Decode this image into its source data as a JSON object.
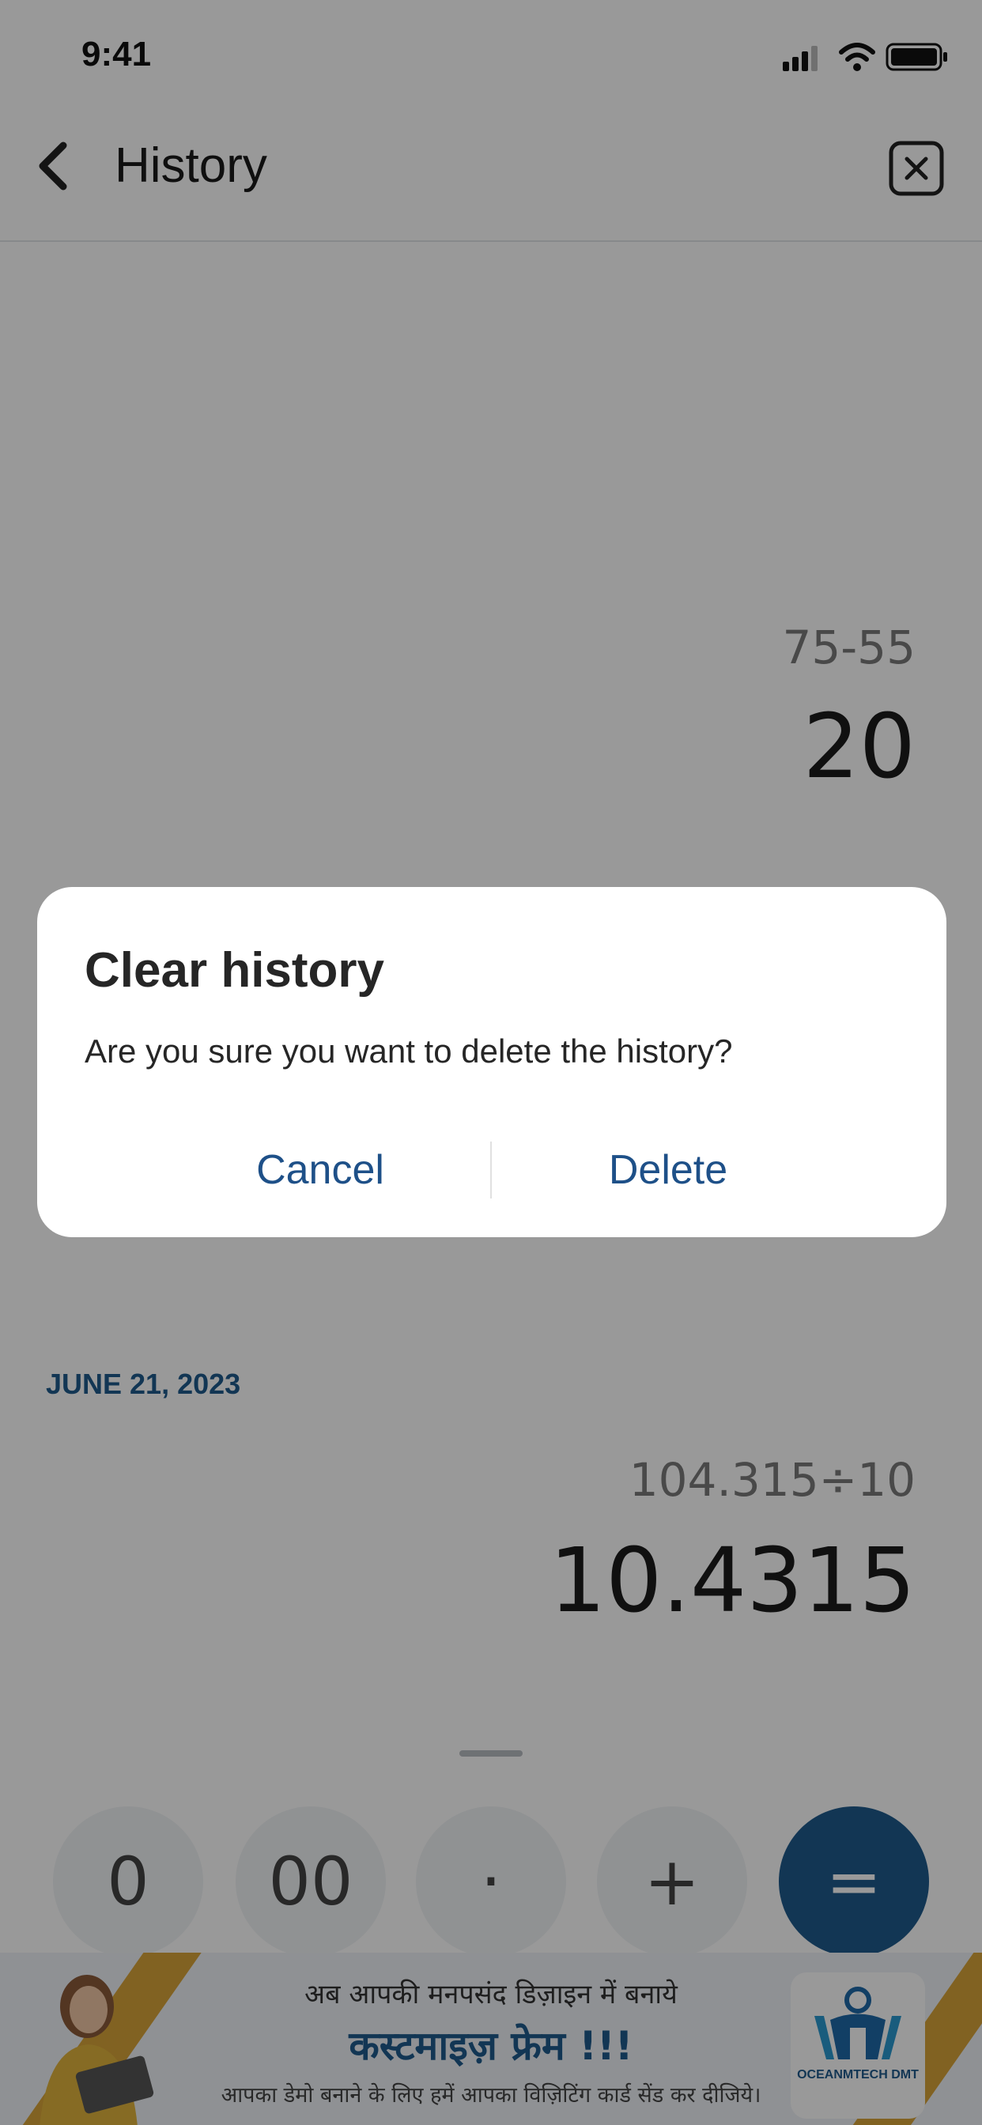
{
  "status_bar": {
    "time": "9:41"
  },
  "header": {
    "title": "History"
  },
  "history": {
    "entries": [
      {
        "expression": "75-55",
        "result": "20"
      },
      {
        "date": "JUNE 21, 2023",
        "expression": "104.315÷10",
        "result": "10.4315"
      }
    ]
  },
  "keypad": {
    "keys": [
      "0",
      "00",
      "·",
      "+",
      "="
    ]
  },
  "banner": {
    "line1": "अब आपकी मनपसंद डिज़ाइन में बनाये",
    "line2": "कस्टमाइज़ फ्रेम !!!",
    "line3": "आपका डेमो बनाने के लिए हमें आपका विज़िटिंग कार्ड सेंड कर दीजिये।",
    "logo_text": "OCEANMTECH DMT"
  },
  "dialog": {
    "title": "Clear history",
    "message": "Are you sure you want to delete the history?",
    "cancel_label": "Cancel",
    "delete_label": "Delete"
  },
  "colors": {
    "accent": "#1e5a8c",
    "scrim": "rgba(0,0,0,0.40)"
  }
}
